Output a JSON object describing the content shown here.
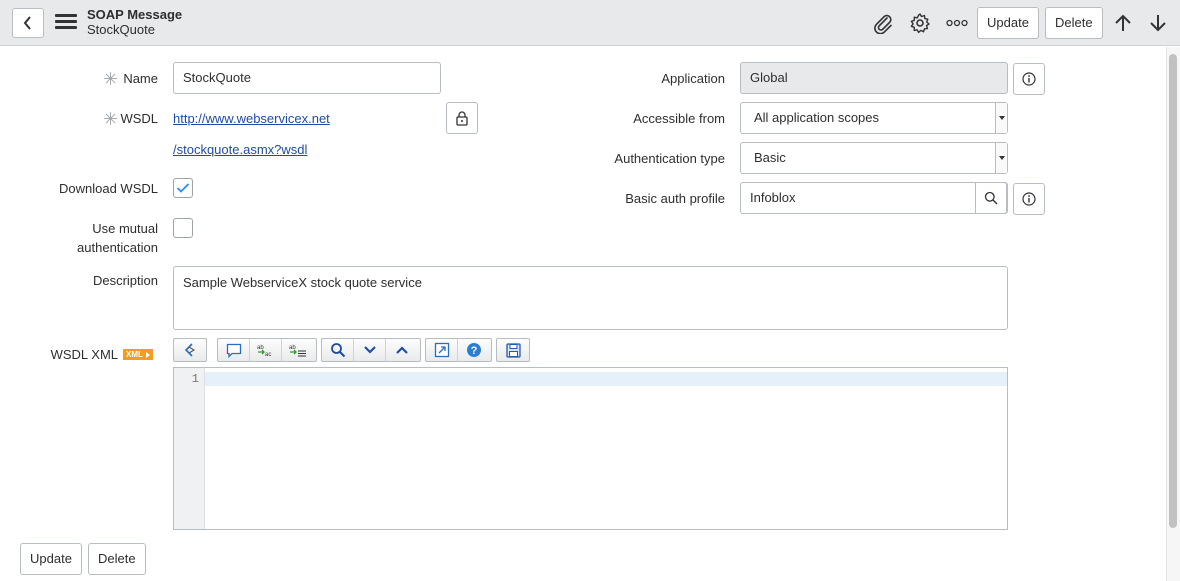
{
  "header": {
    "title": "SOAP Message",
    "subtitle": "StockQuote",
    "update_label": "Update",
    "delete_label": "Delete"
  },
  "form": {
    "name_label": "Name",
    "name_value": "StockQuote",
    "wsdl_label": "WSDL",
    "wsdl_link_line1": "http://www.webservicex.net",
    "wsdl_link_line2": "/stockquote.asmx?wsdl",
    "download_wsdl_label": "Download WSDL",
    "download_wsdl_checked": true,
    "mutual_auth_label_line1": "Use mutual",
    "mutual_auth_label_line2": "authentication",
    "mutual_auth_checked": false,
    "description_label": "Description",
    "description_value": "Sample WebserviceX stock quote service",
    "wsdl_xml_label": "WSDL XML",
    "xml_badge": "XML",
    "application_label": "Application",
    "application_value": "Global",
    "accessible_from_label": "Accessible from",
    "accessible_from_value": "All application scopes",
    "auth_type_label": "Authentication type",
    "auth_type_value": "Basic",
    "basic_auth_profile_label": "Basic auth profile",
    "basic_auth_profile_value": "Infoblox"
  },
  "editor": {
    "line_numbers": [
      "1"
    ]
  },
  "footer": {
    "update_label": "Update",
    "delete_label": "Delete"
  },
  "colors": {
    "header_bg": "#e8e9ea",
    "link": "#1f4ba8",
    "check": "#278efc",
    "xml_badge": "#f39c1f"
  }
}
